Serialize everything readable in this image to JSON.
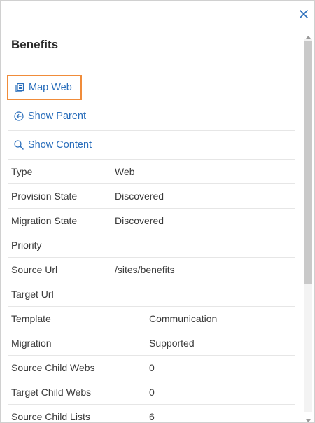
{
  "panel": {
    "title": "Benefits"
  },
  "actions": {
    "map_web": "Map Web",
    "show_parent": "Show Parent",
    "show_content": "Show Content"
  },
  "properties": [
    {
      "label": "Type",
      "value": "Web"
    },
    {
      "label": "Provision State",
      "value": "Discovered"
    },
    {
      "label": "Migration State",
      "value": "Discovered"
    },
    {
      "label": "Priority",
      "value": ""
    },
    {
      "label": "Source Url",
      "value": "/sites/benefits"
    },
    {
      "label": "Target Url",
      "value": ""
    },
    {
      "label": "Template",
      "value": "Communication"
    },
    {
      "label": "Migration",
      "value": "Supported"
    },
    {
      "label": "Source Child Webs",
      "value": "0"
    },
    {
      "label": "Target Child Webs",
      "value": "0"
    },
    {
      "label": "Source Child Lists",
      "value": "6"
    }
  ],
  "colors": {
    "link": "#2a6ebb",
    "focus_outline": "#f08c3a",
    "close": "#2a6ebb"
  },
  "icons": {
    "close": "close-icon",
    "map_web": "pages-icon",
    "show_parent": "arrow-left-circle-icon",
    "show_content": "search-icon"
  }
}
